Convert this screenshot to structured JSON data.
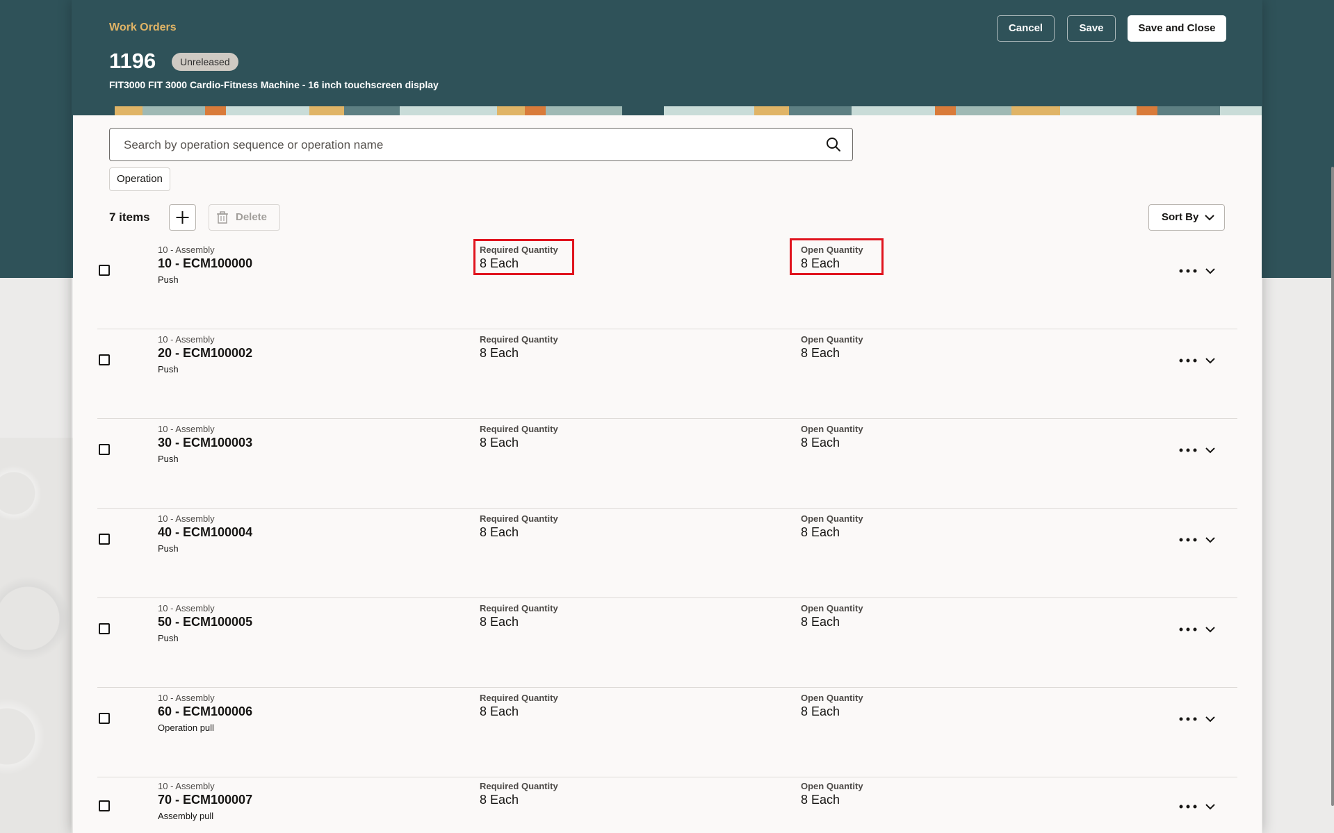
{
  "header": {
    "breadcrumb": "Work Orders",
    "number": "1196",
    "status": "Unreleased",
    "subtitle": "FIT3000 FIT 3000 Cardio-Fitness Machine - 16 inch touchscreen display",
    "cancel_label": "Cancel",
    "save_label": "Save",
    "save_close_label": "Save and Close"
  },
  "search": {
    "placeholder": "Search by operation sequence or operation name"
  },
  "filter_chip": "Operation",
  "toolbar": {
    "count": "7 items",
    "delete_label": "Delete",
    "sort_label": "Sort By"
  },
  "labels": {
    "required": "Required Quantity",
    "open": "Open Quantity"
  },
  "rows": [
    {
      "parent": "10 - Assembly",
      "title": "10 - ECM100000",
      "method": "Push",
      "required": "8 Each",
      "open": "8 Each"
    },
    {
      "parent": "10 - Assembly",
      "title": "20 - ECM100002",
      "method": "Push",
      "required": "8 Each",
      "open": "8 Each"
    },
    {
      "parent": "10 - Assembly",
      "title": "30 - ECM100003",
      "method": "Push",
      "required": "8 Each",
      "open": "8 Each"
    },
    {
      "parent": "10 - Assembly",
      "title": "40 - ECM100004",
      "method": "Push",
      "required": "8 Each",
      "open": "8 Each"
    },
    {
      "parent": "10 - Assembly",
      "title": "50 - ECM100005",
      "method": "Push",
      "required": "8 Each",
      "open": "8 Each"
    },
    {
      "parent": "10 - Assembly",
      "title": "60 - ECM100006",
      "method": "Operation pull",
      "required": "8 Each",
      "open": "8 Each"
    },
    {
      "parent": "10 - Assembly",
      "title": "70 - ECM100007",
      "method": "Assembly pull",
      "required": "8 Each",
      "open": "8 Each"
    }
  ],
  "colors": {
    "header_bg": "#2f5259",
    "breadcrumb": "#e0b466",
    "highlight": "#e0141e"
  }
}
